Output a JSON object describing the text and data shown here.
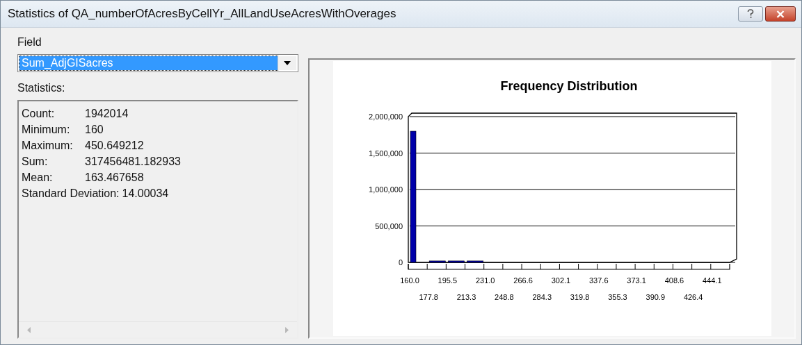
{
  "window": {
    "title": "Statistics of QA_numberOfAcresByCellYr_AllLandUseAcresWithOverages"
  },
  "field": {
    "label": "Field",
    "value": "Sum_AdjGISacres",
    "selected": true
  },
  "statistics": {
    "label": "Statistics:",
    "lines": [
      {
        "label": "Count:",
        "value": "1942014"
      },
      {
        "label": "Minimum:",
        "value": "160"
      },
      {
        "label": "Maximum:",
        "value": "450.649212"
      },
      {
        "label": "Sum:",
        "value": "317456481.182933"
      },
      {
        "label": "Mean:",
        "value": "163.467658"
      },
      {
        "label": "Standard Deviation:",
        "value": "14.00034"
      }
    ]
  },
  "chart": {
    "chart_data": {
      "type": "bar",
      "title": "Frequency Distribution",
      "categories": [
        "160.0",
        "177.8",
        "195.5",
        "213.3",
        "231.0",
        "248.8",
        "266.6",
        "284.3",
        "302.1",
        "319.8",
        "337.6",
        "355.3",
        "373.1",
        "390.9",
        "408.6",
        "426.4",
        "444.1"
      ],
      "series": [
        {
          "color": "#0000aa",
          "values": [
            1800000,
            20000,
            20000,
            20000,
            0,
            0,
            0,
            0,
            0,
            0,
            0,
            0,
            0,
            0,
            0,
            0,
            0
          ]
        }
      ],
      "grid": true,
      "ylim": [
        0,
        2000000
      ],
      "yticks": [
        {
          "value": 0,
          "label": "0"
        },
        {
          "value": 500000,
          "label": "500,000"
        },
        {
          "value": 1000000,
          "label": "1,000,000"
        },
        {
          "value": 1500000,
          "label": "1,500,000"
        },
        {
          "value": 2000000,
          "label": "2,000,000"
        }
      ]
    }
  }
}
